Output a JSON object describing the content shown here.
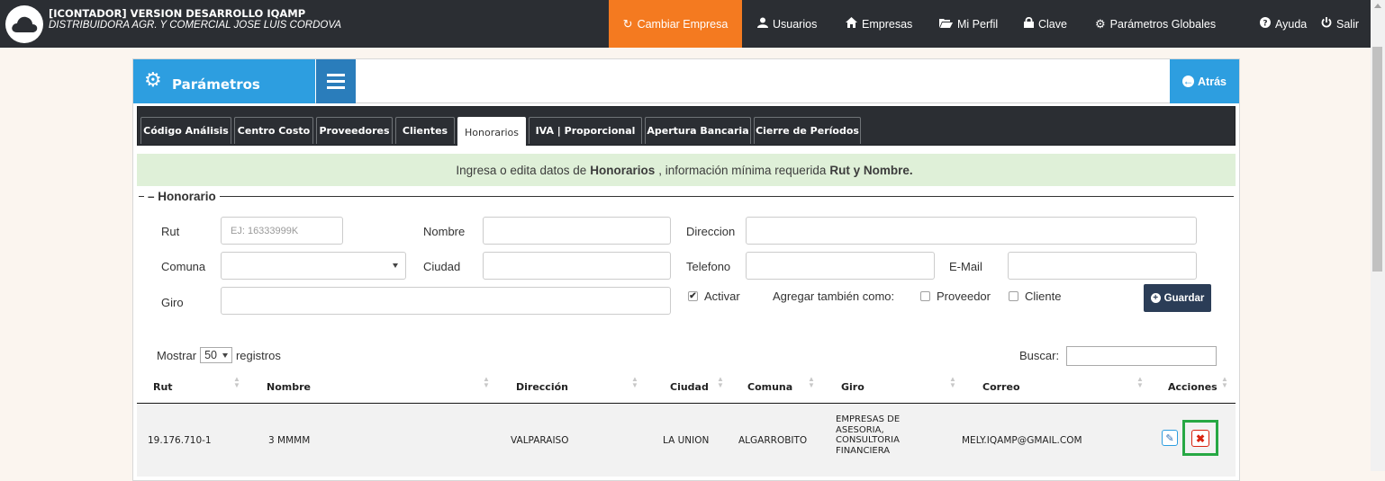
{
  "header": {
    "app_title": "[ICONTADOR] VERSION DESARROLLO IQAMP",
    "company": "DISTRIBUIDORA AGR. Y COMERCIAL JOSE LUIS CORDOVA",
    "nav": {
      "cambiar_empresa": "Cambiar Empresa",
      "usuarios": "Usuarios",
      "empresas": "Empresas",
      "mi_perfil": "Mi Perfil",
      "clave": "Clave",
      "parametros_globales": "Parámetros Globales",
      "ayuda": "Ayuda",
      "salir": "Salir"
    },
    "colors": {
      "bar": "#2b2e33",
      "active": "#f47a20"
    }
  },
  "panel": {
    "title": "Parámetros",
    "back_label": "Atrás",
    "tabs": [
      {
        "label": "Código Análisis"
      },
      {
        "label": "Centro Costo"
      },
      {
        "label": "Proveedores"
      },
      {
        "label": "Clientes"
      },
      {
        "label": "Honorarios",
        "active": true
      },
      {
        "label": "IVA | Proporcional"
      },
      {
        "label": "Apertura Bancaria"
      },
      {
        "label": "Cierre de Períodos"
      }
    ],
    "info": {
      "pre": "Ingresa o edita datos de",
      "entity": "Honorarios",
      "mid": ", información mínima requerida",
      "required": "Rut y Nombre."
    }
  },
  "form": {
    "legend": "Honorario",
    "rut_label": "Rut",
    "rut_placeholder": "EJ: 16333999K",
    "nombre_label": "Nombre",
    "direccion_label": "Direccion",
    "comuna_label": "Comuna",
    "ciudad_label": "Ciudad",
    "telefono_label": "Telefono",
    "email_label": "E-Mail",
    "giro_label": "Giro",
    "activar_label": "Activar",
    "activar_checked": true,
    "agregar_label": "Agregar también como:",
    "proveedor_label": "Proveedor",
    "cliente_label": "Cliente",
    "save_label": "Guardar"
  },
  "table": {
    "mostrar_label": "Mostrar",
    "page_size": "50",
    "registros_label": "registros",
    "buscar_label": "Buscar:",
    "columns": [
      "Rut",
      "Nombre",
      "Dirección",
      "Ciudad",
      "Comuna",
      "Giro",
      "Correo",
      "Acciones"
    ],
    "rows": [
      {
        "rut": "19.176.710-1",
        "nombre": "3 MMMM",
        "direccion": "VALPARAISO",
        "ciudad": "LA UNION",
        "comuna": "ALGARROBITO",
        "giro": "EMPRESAS DE ASESORIA, CONSULTORIA FINANCIERA",
        "correo": "MELY.IQAMP@GMAIL.COM"
      }
    ]
  },
  "icons": {
    "logo": "cloud-icon",
    "cambiar": "refresh-icon",
    "usuarios": "user-icon",
    "empresas": "home-icon",
    "mi_perfil": "folder-open-icon",
    "clave": "lock-icon",
    "parametros": "cog-icon",
    "ayuda": "question-icon",
    "salir": "power-icon",
    "edit": "pencil-icon",
    "delete": "times-icon"
  }
}
